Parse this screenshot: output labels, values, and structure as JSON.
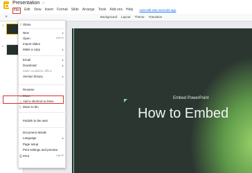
{
  "app": {
    "title": "Presentation",
    "menu": [
      "File",
      "Edit",
      "View",
      "Insert",
      "Format",
      "Slide",
      "Arrange",
      "Tools",
      "Add-ons",
      "Help"
    ],
    "last_edit": "Last edit was seconds ago"
  },
  "toolbar": {
    "add": "+",
    "items": [
      "Background",
      "Layout",
      "Theme",
      "Transition"
    ]
  },
  "thumbnails": [
    "1",
    "2"
  ],
  "file_menu": {
    "share": "Share",
    "new": "New",
    "open": "Open",
    "open_sc": "Ctrl+O",
    "import_slides": "Import slides",
    "make_copy": "Make a copy",
    "email": "Email",
    "download": "Download",
    "make_offline": "Make available offline",
    "version_history": "Version history",
    "rename": "Rename",
    "move": "Move",
    "add_shortcut": "Add a shortcut to Drive",
    "move_to_bin": "Move to bin",
    "publish": "Publish to the web",
    "document_details": "Document details",
    "language": "Language",
    "page_setup": "Page setup",
    "print_settings": "Print settings and preview",
    "print": "Print",
    "print_sc": "Ctrl+P"
  },
  "slide": {
    "subtitle": "Embed PowerPoint",
    "title": "How to Embed"
  }
}
